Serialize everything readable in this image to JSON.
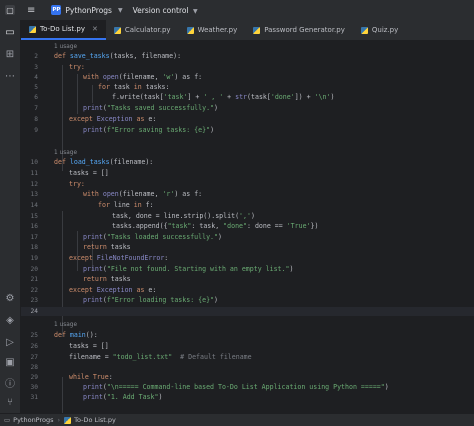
{
  "titlebar": {
    "project_badge": "PP",
    "project": "PythonProgs",
    "vcs": "Version control"
  },
  "tabs": [
    {
      "label": "To-Do List.py",
      "active": true
    },
    {
      "label": "Calculator.py"
    },
    {
      "label": "Weather.py"
    },
    {
      "label": "Password Generator.py"
    },
    {
      "label": "Quiz.py"
    }
  ],
  "usage_hints": [
    "1 usage",
    "1 usage",
    "1 usage"
  ],
  "code": {
    "l2": "def save_tasks(tasks, filename):",
    "l3": "try:",
    "l4a": "with ",
    "l4b": "open",
    "l4c": "(filename, ",
    "l4d": "'w'",
    "l4e": ") as f:",
    "l5a": "for ",
    "l5b": "task ",
    "l5c": "in ",
    "l5d": "tasks:",
    "l6a": "f.write(task[",
    "l6b": "'task'",
    "l6c": "] + ",
    "l6d": "' , '",
    "l6e": " + ",
    "l6f": "str",
    "l6g": "(task[",
    "l6h": "'done'",
    "l6i": "]) + ",
    "l6j": "'\\n'",
    "l6k": ")",
    "l7a": "print",
    "l7b": "(",
    "l7c": "\"Tasks saved successfully.\"",
    "l7d": ")",
    "l8a": "except ",
    "l8b": "Exception ",
    "l8c": "as ",
    "l8d": "e:",
    "l9a": "print",
    "l9b": "(",
    "l9c": "f\"Error saving tasks: {e}\"",
    "l9d": ")",
    "l10a": "def ",
    "l10b": "load_tasks",
    "l10c": "(filename):",
    "l11": "tasks = []",
    "l12": "try:",
    "l13a": "with ",
    "l13b": "open",
    "l13c": "(filename, ",
    "l13d": "'r'",
    "l13e": ") as f:",
    "l14a": "for ",
    "l14b": "line ",
    "l14c": "in ",
    "l14d": "f:",
    "l15a": "task, done = line.strip().split(",
    "l15b": "','",
    "l15c": ")",
    "l16a": "tasks.append({",
    "l16b": "\"task\"",
    "l16c": ": task, ",
    "l16d": "\"done\"",
    "l16e": ": done == ",
    "l16f": "'True'",
    "l16g": "})",
    "l17a": "print",
    "l17b": "(",
    "l17c": "\"Tasks loaded successfully.\"",
    "l17d": ")",
    "l18a": "return ",
    "l18b": "tasks",
    "l19a": "except ",
    "l19b": "FileNotFoundError",
    "l19c": ":",
    "l20a": "print",
    "l20b": "(",
    "l20c": "\"File not found. Starting with an empty list.\"",
    "l20d": ")",
    "l21a": "return ",
    "l21b": "tasks",
    "l22a": "except ",
    "l22b": "Exception ",
    "l22c": "as ",
    "l22d": "e:",
    "l23a": "print",
    "l23b": "(",
    "l23c": "f\"Error loading tasks: {e}\"",
    "l23d": ")",
    "l25a": "def ",
    "l25b": "main",
    "l25c": "():",
    "l26": "tasks = []",
    "l27a": "filename = ",
    "l27b": "\"todo_list.txt\"",
    "l27c": "  # Default filename",
    "l29a": "while ",
    "l29b": "True",
    "l29c": ":",
    "l30a": "print",
    "l30b": "(",
    "l30c": "\"\\n===== Command-line based To-Do List Application using Python =====\"",
    "l30d": ")",
    "l31a": "print",
    "l31b": "(",
    "l31c": "\"1. Add Task\"",
    "l31d": ")"
  },
  "line_numbers": [
    "2",
    "3",
    "4",
    "5",
    "6",
    "7",
    "8",
    "9",
    "10",
    "11",
    "12",
    "13",
    "14",
    "15",
    "16",
    "17",
    "18",
    "19",
    "20",
    "21",
    "22",
    "23",
    "24",
    "25",
    "26",
    "27",
    "28",
    "29",
    "30",
    "31"
  ],
  "statusbar": {
    "project": "PythonProgs",
    "file": "To-Do List.py"
  }
}
